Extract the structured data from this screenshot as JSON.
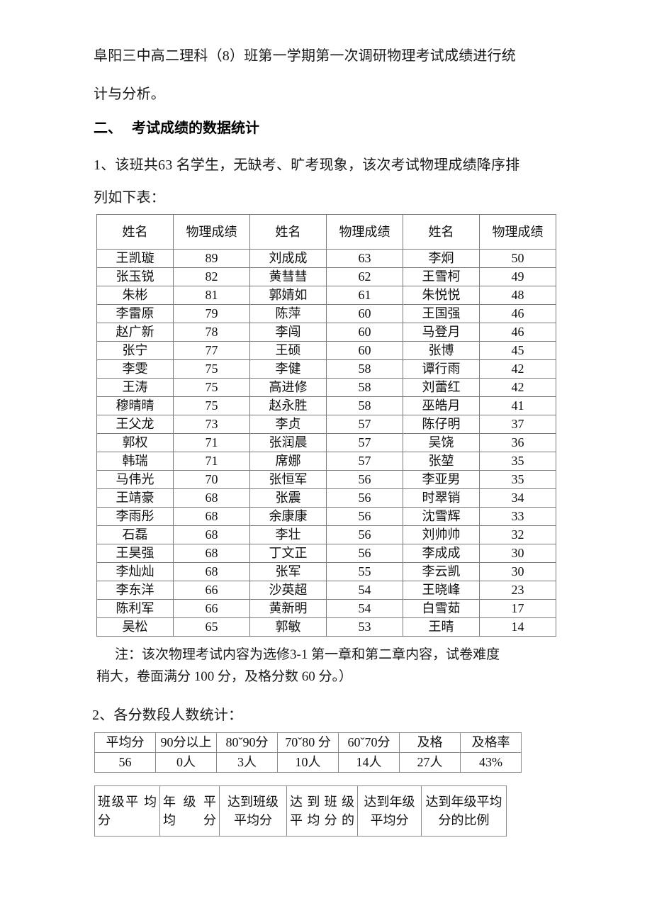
{
  "document": {
    "intro_line_1": "阜阳三中高二理科（8）班第一学期第一次调研物理考试成绩进行统",
    "intro_line_2": "计与分析。",
    "section_number": "二、",
    "section_title": "考试成绩的数据统计",
    "item1_line_1": "1、该班共63 名学生，无缺考、旷考现象，该次考试物理成绩降序排",
    "item1_line_2": "列如下表：",
    "note_line_1": "注：该次物理考试内容为选修3-1 第一章和第二章内容，试卷难度",
    "note_line_2": "稍大，卷面满分 100 分，及格分数 60 分。）",
    "item2": "2、各分数段人数统计："
  },
  "score_table": {
    "headers": [
      "姓名",
      "物理成绩",
      "姓名",
      "物理成绩",
      "姓名",
      "物理成绩"
    ],
    "rows": [
      [
        "王凯璇",
        "89",
        "刘成成",
        "63",
        "李炯",
        "50"
      ],
      [
        "张玉锐",
        "82",
        "黄彗彗",
        "62",
        "王雪柯",
        "49"
      ],
      [
        "朱彬",
        "81",
        "郭婧如",
        "61",
        "朱悦悦",
        "48"
      ],
      [
        "李雷原",
        "79",
        "陈萍",
        "60",
        "王国强",
        "46"
      ],
      [
        "赵广新",
        "78",
        "李闯",
        "60",
        "马登月",
        "46"
      ],
      [
        "张宁",
        "77",
        "王硕",
        "60",
        "张博",
        "45"
      ],
      [
        "李雯",
        "75",
        "李健",
        "58",
        "谭行雨",
        "42"
      ],
      [
        "王涛",
        "75",
        "高进修",
        "58",
        "刘蕾红",
        "42"
      ],
      [
        "穆晴晴",
        "75",
        "赵永胜",
        "58",
        "巫皓月",
        "41"
      ],
      [
        "王父龙",
        "73",
        "李贞",
        "57",
        "陈仔明",
        "37"
      ],
      [
        "郭权",
        "71",
        "张润晨",
        "57",
        "吴饶",
        "36"
      ],
      [
        "韩瑞",
        "71",
        "席娜",
        "57",
        "张堃",
        "35"
      ],
      [
        "马伟光",
        "70",
        "张恒军",
        "56",
        "李亚男",
        "35"
      ],
      [
        "王靖豪",
        "68",
        "张震",
        "56",
        "时翠销",
        "34"
      ],
      [
        "李雨彤",
        "68",
        "余康康",
        "56",
        "沈雪辉",
        "33"
      ],
      [
        "石磊",
        "68",
        "李壮",
        "56",
        "刘帅帅",
        "32"
      ],
      [
        "王昊强",
        "68",
        "丁文正",
        "56",
        "李成成",
        "30"
      ],
      [
        "李灿灿",
        "68",
        "张军",
        "55",
        "李云凯",
        "30"
      ],
      [
        "李东洋",
        "66",
        "沙英超",
        "54",
        "王晓峰",
        "23"
      ],
      [
        "陈利军",
        "66",
        "黄新明",
        "54",
        "白雪茹",
        "17"
      ],
      [
        "吴松",
        "65",
        "郭敏",
        "53",
        "王晴",
        "14"
      ]
    ]
  },
  "distribution_table": {
    "headers": [
      "平均分",
      "90分以上",
      "80ˇ90分",
      "70ˇ80 分",
      "60ˇ70分",
      "及格",
      "及格率"
    ],
    "values": [
      "56",
      "0人",
      "3人",
      "10人",
      "14人",
      "27人",
      "43%"
    ]
  },
  "comparison_table": {
    "headers": [
      "班级平 均分",
      "年级平 均分",
      "达到班级平均分",
      "达到班级 平均分的",
      "达到年级平均分",
      "达到年级平均分的比例"
    ]
  },
  "chart_data": {
    "type": "table",
    "title": "各分数段人数统计",
    "categories": [
      "90分以上",
      "80ˇ90分",
      "70ˇ80 分",
      "60ˇ70分",
      "及格"
    ],
    "values": [
      0,
      3,
      10,
      14,
      27
    ],
    "xlabel": "分数段",
    "ylabel": "人数",
    "annotations": [
      "平均分 56",
      "及格率 43%",
      "总人数 63",
      "卷面满分 100 分",
      "及格分数 60 分"
    ]
  }
}
